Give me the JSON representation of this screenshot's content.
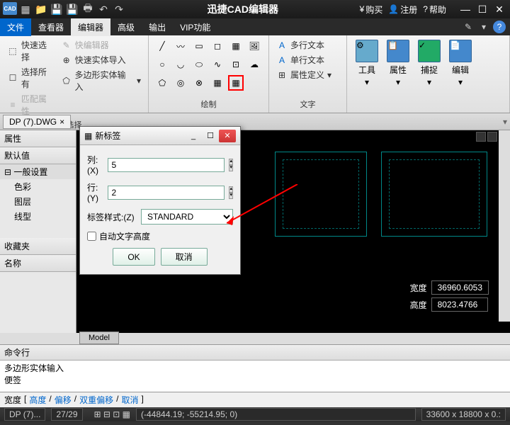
{
  "title": "迅捷CAD编辑器",
  "titlebar_right": {
    "buy": "购买",
    "register": "注册",
    "help": "帮助"
  },
  "menus": {
    "file": "文件",
    "viewer": "查看器",
    "editor": "编辑器",
    "advanced": "高级",
    "output": "输出",
    "vip": "VIP功能"
  },
  "ribbon": {
    "select_group": {
      "quick_select": "快速选择",
      "select_all": "选择所有",
      "match_props": "匹配属性",
      "quick_editor": "快编辑器",
      "quick_import": "快速实体导入",
      "poly_input": "多边形实体输入",
      "label": "选择"
    },
    "draw_label": "绘制",
    "text_group": {
      "mtext": "多行文本",
      "stext": "单行文本",
      "attdef": "属性定义",
      "label": "文字"
    },
    "tools": {
      "tools": "工具",
      "props": "属性",
      "snap": "捕捉",
      "edit": "编辑"
    }
  },
  "doc_tab": "DP (7).DWG",
  "side": {
    "props": "属性",
    "defaults": "默认值",
    "general": "一般设置",
    "color": "色彩",
    "layer": "图层",
    "linetype": "线型",
    "favorites": "收藏夹",
    "name": "名称"
  },
  "dialog": {
    "title": "新标签",
    "cols_label": "列:(X)",
    "cols_val": "5",
    "rows_label": "行:(Y)",
    "rows_val": "2",
    "style_label": "标签样式:(Z)",
    "style_val": "STANDARD",
    "auto_height": "自动文字高度",
    "ok": "OK",
    "cancel": "取消"
  },
  "dims": {
    "width_label": "宽度",
    "width_val": "36960.6053",
    "height_label": "高度",
    "height_val": "8023.4766"
  },
  "model_tab": "Model",
  "cmd": {
    "header": "命令行",
    "line1": "多边形实体输入",
    "line2": "便签"
  },
  "status1": {
    "width": "宽度",
    "height": "高度",
    "offset": "偏移",
    "double_offset": "双重偏移",
    "cancel": "取消"
  },
  "status2": {
    "file": "DP (7)...",
    "pages": "27/29",
    "coords": "(-44844.19; -55214.95; 0)",
    "size": "33600 x 18800 x 0.:"
  }
}
